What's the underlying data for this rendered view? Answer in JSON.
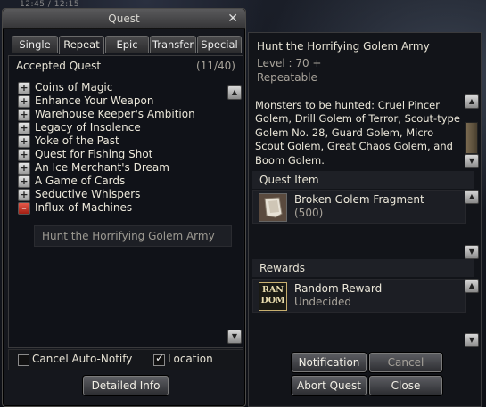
{
  "hud": {
    "time": "12:45 / 12:15"
  },
  "window": {
    "title": "Quest",
    "close_glyph": "✕"
  },
  "tabs": [
    {
      "label": "Single"
    },
    {
      "label": "Repeat",
      "active": true
    },
    {
      "label": "Epic"
    },
    {
      "label": "Transfer"
    },
    {
      "label": "Special"
    }
  ],
  "list": {
    "header": "Accepted Quest",
    "count": "(11/40)",
    "quests": [
      "Coins of Magic",
      "Enhance Your Weapon",
      "Warehouse Keeper's Ambition",
      "Legacy of Insolence",
      "Yoke of the Past",
      "Quest for Fishing Shot",
      "An Ice Merchant's Dream",
      "A Game of Cards",
      "Seductive Whispers",
      "Influx of Machines"
    ],
    "expanded_subquest": "Hunt the Horrifying Golem Army"
  },
  "options": {
    "cancel_auto_notify": {
      "label": "Cancel Auto-Notify",
      "checked": false
    },
    "location": {
      "label": "Location",
      "checked": true
    }
  },
  "buttons": {
    "detailed_info": "Detailed Info",
    "notification": "Notification",
    "cancel": "Cancel",
    "abort_quest": "Abort Quest",
    "close": "Close"
  },
  "detail": {
    "title": "Hunt the Horrifying Golem Army",
    "level": "Level : 70 +",
    "type": "Repeatable",
    "description": "Monsters to be hunted: Cruel Pincer Golem, Drill Golem of Terror, Scout-type Golem No. 28, Guard Golem, Micro Scout Golem, Great Chaos Golem, and Boom Golem.",
    "quest_item_header": "Quest Item",
    "quest_item": {
      "name": "Broken Golem Fragment",
      "qty": "(500)",
      "icon": "golem-fragment-icon"
    },
    "rewards_header": "Rewards",
    "reward": {
      "name": "Random Reward",
      "status": "Undecided",
      "icon": "random-reward-icon",
      "icon_text_top": "RAN",
      "icon_text_bottom": "DOM"
    }
  },
  "colors": {
    "window_bg": "#15171d",
    "text": "#e6e2d4",
    "muted": "#a8a39a",
    "minus": "#c0392b"
  }
}
